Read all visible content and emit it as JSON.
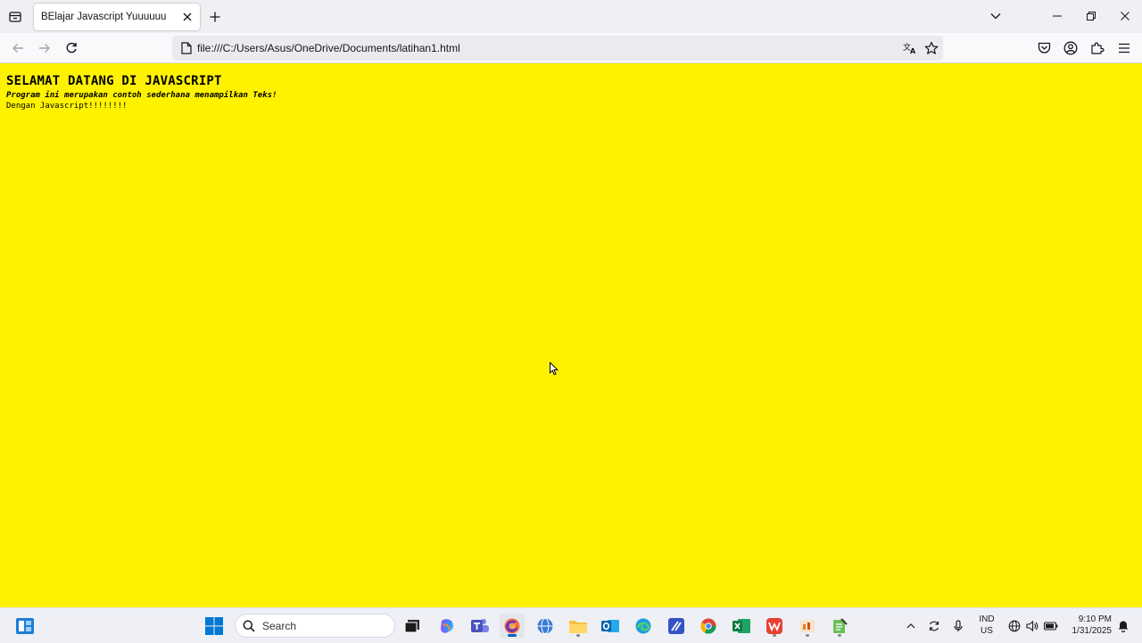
{
  "browser": {
    "tab_title": "BElajar Javascript Yuuuuuu",
    "url": "file:///C:/Users/Asus/OneDrive/Documents/latihan1.html"
  },
  "page": {
    "heading": "SELAMAT DATANG DI JAVASCRIPT",
    "line1": "Program ini merupakan contoh sederhana menampilkan Teks!",
    "line2": "Dengan Javascript!!!!!!!!",
    "background_color": "#fff200"
  },
  "taskbar": {
    "search_placeholder": "Search",
    "language": [
      "IND",
      "US"
    ],
    "time": "9:10 PM",
    "date": "1/31/2025"
  },
  "colors": {
    "accent": "#0067c0",
    "page_bg": "#fff200"
  }
}
